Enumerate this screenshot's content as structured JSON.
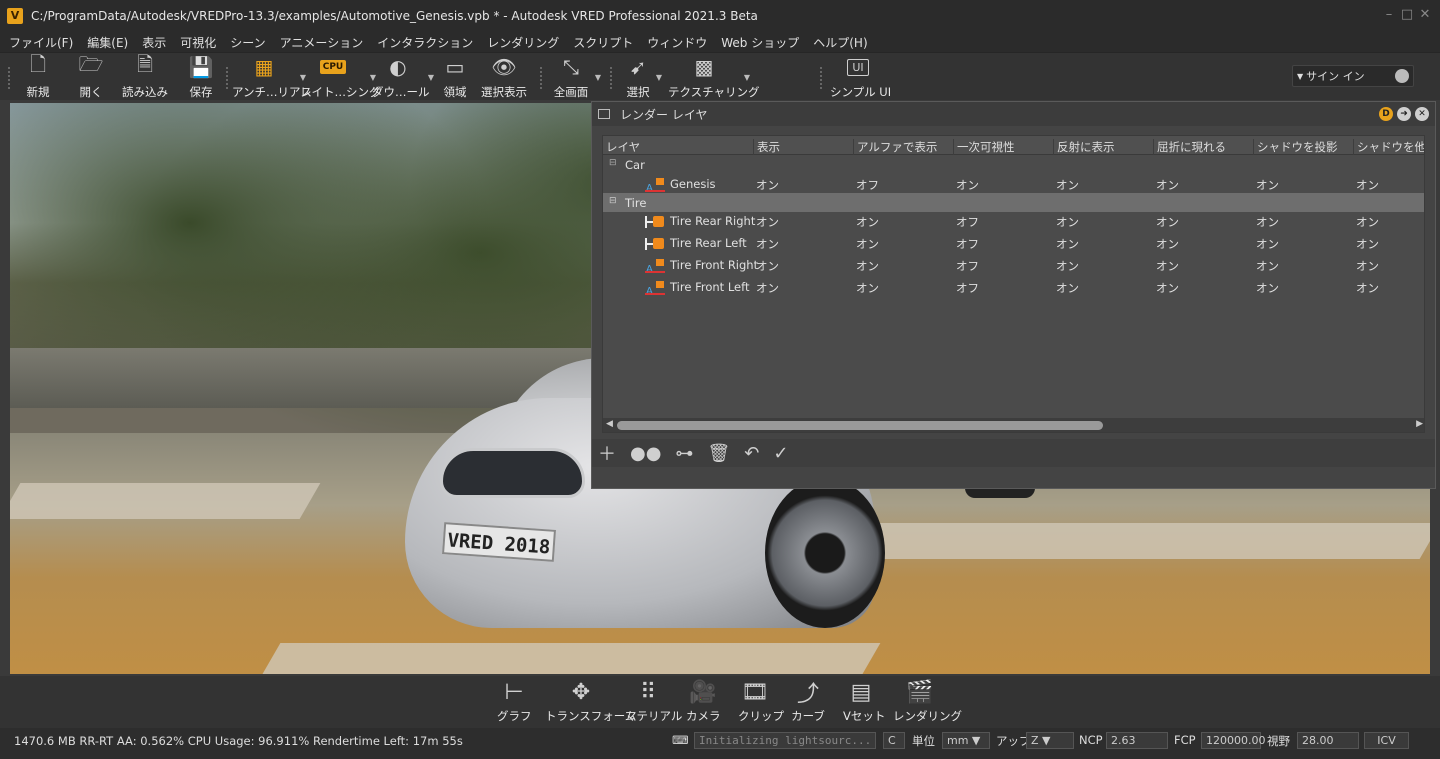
{
  "window": {
    "title": "C:/ProgramData/Autodesk/VREDPro-13.3/examples/Automotive_Genesis.vpb * - Autodesk VRED Professional 2021.3 Beta",
    "app_icon": "V"
  },
  "menu": [
    "ファイル(F)",
    "編集(E)",
    "表示",
    "可視化",
    "シーン",
    "アニメーション",
    "インタラクション",
    "レンダリング",
    "スクリプト",
    "ウィンドウ",
    "Web ショップ",
    "ヘルプ(H)"
  ],
  "toolbar": {
    "new": "新規",
    "open": "開く",
    "import": "読み込み",
    "save": "保存",
    "antialias": "アンチ…リアス",
    "raytracing": "レイト…シング",
    "download": "ダウ…ール",
    "region": "領域",
    "select_display": "選択表示",
    "fullscreen": "全画面",
    "select": "選択",
    "texturing": "テクスチャリング",
    "simple_ui": "シンプル UI",
    "cpu_badge": "CPU",
    "ui_badge": "UI",
    "sign_in": "サイン イン"
  },
  "panel": {
    "title": "レンダー レイヤ",
    "columns": [
      "レイヤ",
      "表示",
      "アルファで表示",
      "一次可視性",
      "反射に表示",
      "屈折に現れる",
      "シャドウを投影",
      "シャドウを他から"
    ],
    "groups": [
      {
        "name": "Car",
        "rows": [
          {
            "name": "Genesis",
            "values": [
              "オン",
              "オフ",
              "オン",
              "オン",
              "オン",
              "オン",
              "オン"
            ]
          }
        ]
      },
      {
        "name": "Tire",
        "rows": [
          {
            "name": "Tire Rear Right",
            "values": [
              "オン",
              "オン",
              "オフ",
              "オン",
              "オン",
              "オン",
              "オン"
            ]
          },
          {
            "name": "Tire Rear Left",
            "values": [
              "オン",
              "オン",
              "オフ",
              "オン",
              "オン",
              "オン",
              "オン"
            ]
          },
          {
            "name": "Tire Front Right",
            "values": [
              "オン",
              "オン",
              "オフ",
              "オン",
              "オン",
              "オン",
              "オン"
            ]
          },
          {
            "name": "Tire Front Left",
            "values": [
              "オン",
              "オン",
              "オフ",
              "オン",
              "オン",
              "オン",
              "オン"
            ]
          }
        ]
      }
    ]
  },
  "viewport": {
    "plate_text": "VRED 2018"
  },
  "bottom_tools": [
    "グラフ",
    "トランスフォーム",
    "マテリアル",
    "カメラ",
    "クリップ",
    "カーブ",
    "Vセット",
    "レンダリング"
  ],
  "status": {
    "text": "1470.6 MB  RR-RT AA: 0.562% CPU Usage: 96.911% Rendertime Left: 17m 55s",
    "progress_placeholder": "Initializing lightsourc...",
    "unit_label": "単位",
    "unit_value": "mm",
    "up_label": "アップ",
    "up_value": "Z",
    "ncp_label": "NCP",
    "ncp_value": "2.63",
    "fcp_label": "FCP",
    "fcp_value": "120000.00",
    "fov_label": "視野",
    "fov_value": "28.00",
    "icv": "ICV"
  }
}
